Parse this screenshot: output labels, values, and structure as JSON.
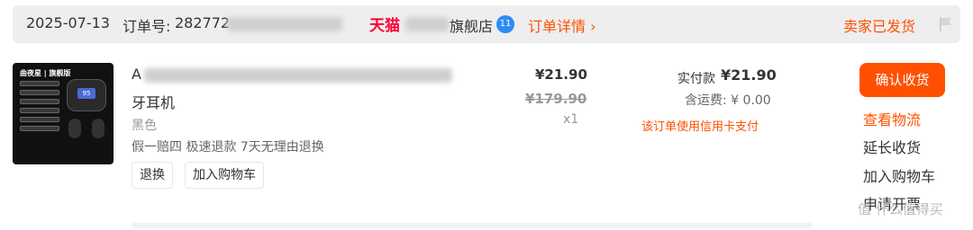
{
  "header": {
    "date": "2025-07-13",
    "order_no_label": "订单号:",
    "order_no": "282772",
    "store_logo": "天猫",
    "store_suffix": "旗舰店",
    "im_badge": "11",
    "order_detail_link": "订单详情 ›",
    "status": "卖家已发货",
    "flag_icon": "flag-icon"
  },
  "product": {
    "thumb_brand": "曲夜星 | 旗舰版",
    "thumb_screen": "95",
    "title_line1": "A",
    "title_line2": "牙耳机",
    "sku": "黑色",
    "services": "假一赔四 极速退款 7天无理由退换",
    "price": "¥21.90",
    "original_price": "¥179.90",
    "quantity": "x1",
    "buttons": [
      "退换",
      "加入购物车"
    ]
  },
  "payment": {
    "paid_label": "实付款",
    "paid_amount": "¥21.90",
    "shipping": "含运费: ¥ 0.00",
    "credit_note": "该订单使用信用卡支付"
  },
  "actions": {
    "confirm": "确认收货",
    "view_logistics": "查看物流",
    "extend_receipt": "延长收货",
    "add_to_cart": "加入购物车",
    "request_invoice": "申请开票"
  },
  "watermark": "值 什么值得买",
  "colors": {
    "accent": "#ff5000",
    "tmall": "#ff0036",
    "header_bg": "#eeeeee"
  }
}
